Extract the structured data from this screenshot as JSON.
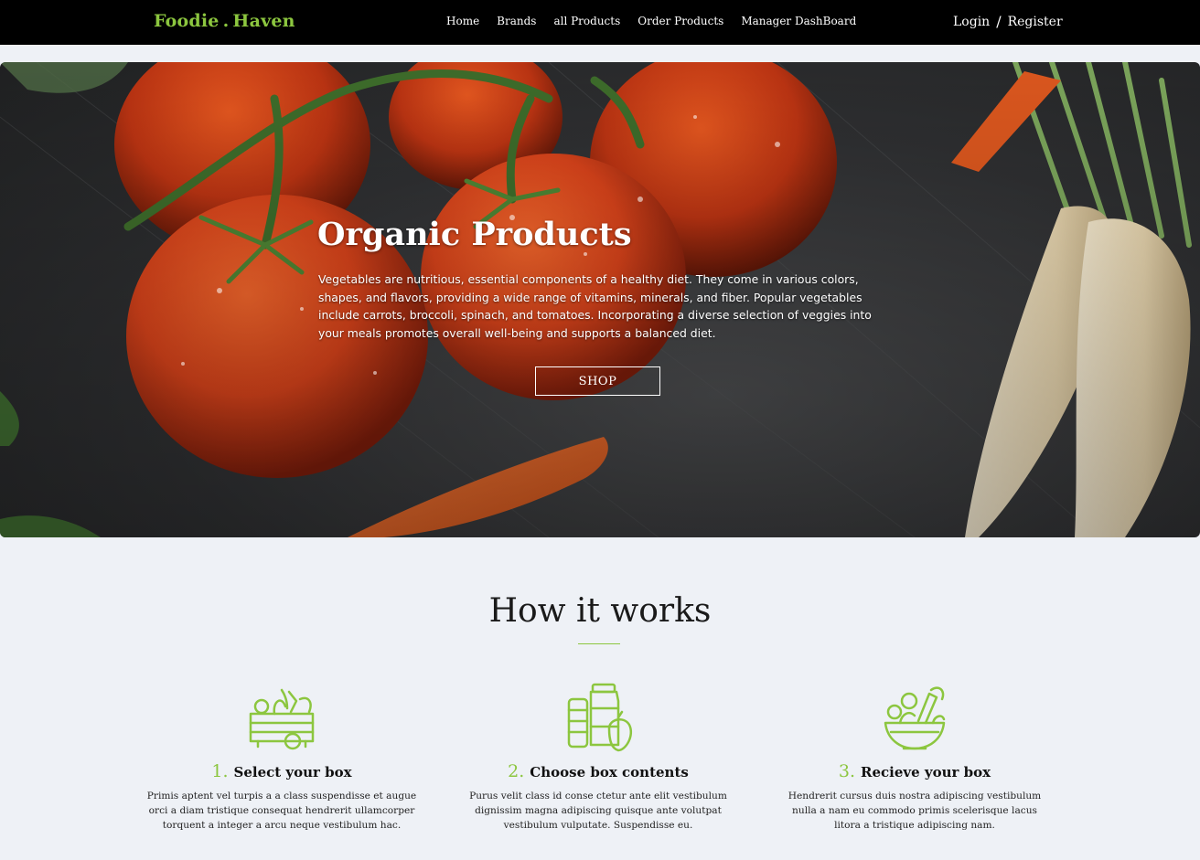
{
  "brand": {
    "part1": "Foodie",
    "dot": ".",
    "part2": "Haven"
  },
  "nav": {
    "items": [
      "Home",
      "Brands",
      "all Products",
      "Order Products",
      "Manager DashBoard"
    ],
    "login": "Login",
    "separator": "/",
    "register": "Register"
  },
  "hero": {
    "title": "Organic Products",
    "text": "Vegetables are nutritious, essential components of a healthy diet. They come in various colors, shapes, and flavors, providing a wide range of vitamins, minerals, and fiber. Popular vegetables include carrots, broccoli, spinach, and tomatoes. Incorporating a diverse selection of veggies into your meals promotes overall well-being and supports a balanced diet.",
    "button": "SHOP"
  },
  "how": {
    "title": "How it works",
    "steps": [
      {
        "num": "1.",
        "title": "Select your box",
        "text": "Primis aptent vel turpis a a class suspendisse et augue orci a diam tristique consequat hendrerit ullamcorper torquent a integer a arcu neque vestibulum hac.",
        "icon": "vegetable-crate-icon"
      },
      {
        "num": "2.",
        "title": "Choose box contents",
        "text": "Purus velit class id conse ctetur ante elit vestibulum dignissim magna adipiscing quisque ante volutpat vestibulum vulputate. Suspendisse eu.",
        "icon": "groceries-icon"
      },
      {
        "num": "3.",
        "title": "Recieve your box",
        "text": "Hendrerit cursus duis nostra adipiscing vestibulum nulla a nam eu commodo primis scelerisque lacus litora a tristique adipiscing nam.",
        "icon": "salad-bowl-icon"
      }
    ]
  },
  "colors": {
    "accent": "#8cc63f",
    "nav_bg": "#000000",
    "page_bg": "#eef1f6"
  }
}
